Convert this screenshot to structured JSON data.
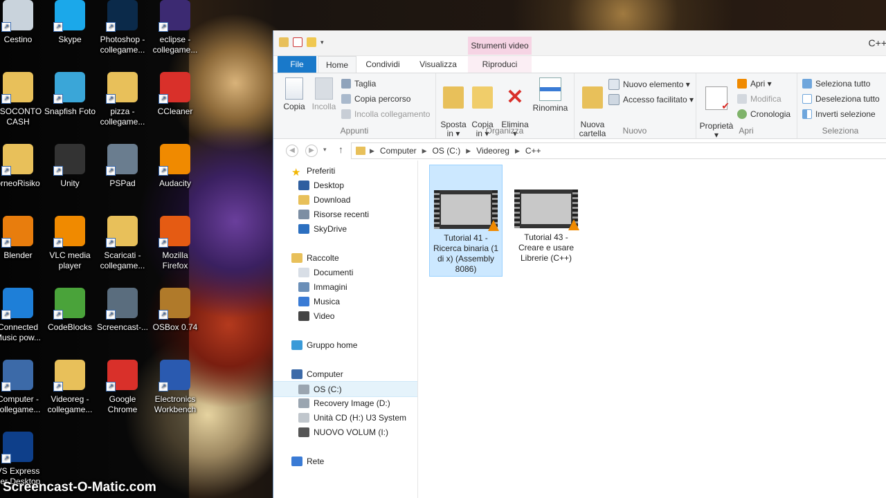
{
  "desktop": {
    "icons": [
      {
        "label": "Cestino",
        "icon": "recycle-bin-icon"
      },
      {
        "label": "Skype",
        "icon": "skype-icon"
      },
      {
        "label": "Photoshop -\ncollegame...",
        "icon": "photoshop-icon"
      },
      {
        "label": "eclipse -\ncollegame...",
        "icon": "eclipse-icon"
      },
      {
        "label": "ESOCONTO\nCASH",
        "icon": "folder-icon"
      },
      {
        "label": "Snapfish Foto",
        "icon": "snapfish-icon"
      },
      {
        "label": "pizza -\ncollegame...",
        "icon": "folder-icon"
      },
      {
        "label": "CCleaner",
        "icon": "ccleaner-icon"
      },
      {
        "label": "orneoRisiko",
        "icon": "folder-icon"
      },
      {
        "label": "Unity",
        "icon": "unity-icon"
      },
      {
        "label": "PSPad",
        "icon": "pspad-icon"
      },
      {
        "label": "Audacity",
        "icon": "audacity-icon"
      },
      {
        "label": "Blender",
        "icon": "blender-icon"
      },
      {
        "label": "VLC media\nplayer",
        "icon": "vlc-icon"
      },
      {
        "label": "Scaricati -\ncollegame...",
        "icon": "folder-icon"
      },
      {
        "label": "Mozilla\nFirefox",
        "icon": "firefox-icon"
      },
      {
        "label": "Connected\nMusic pow...",
        "icon": "music-icon"
      },
      {
        "label": "CodeBlocks",
        "icon": "codeblocks-icon"
      },
      {
        "label": "Screencast-...",
        "icon": "screencast-icon"
      },
      {
        "label": "OSBox 0.74",
        "icon": "dosbox-icon"
      },
      {
        "label": "Computer -\ncollegame...",
        "icon": "computer-icon"
      },
      {
        "label": "Videoreg -\ncollegame...",
        "icon": "folder-icon"
      },
      {
        "label": "Google\nChrome",
        "icon": "chrome-icon"
      },
      {
        "label": "Electronics\nWorkbench",
        "icon": "electronics-workbench-icon"
      },
      {
        "label": "VS Express\nper Desktop",
        "icon": "visual-studio-icon"
      }
    ]
  },
  "window": {
    "title": "C++",
    "contextual_tab": "Strumenti video",
    "tabs": [
      "File",
      "Home",
      "Condividi",
      "Visualizza",
      "Riproduci"
    ],
    "ribbon": {
      "appunti": {
        "label": "Appunti",
        "copia": "Copia",
        "incolla": "Incolla",
        "taglia": "Taglia",
        "copia_percorso": "Copia percorso",
        "incolla_collegamento": "Incolla collegamento"
      },
      "organizza": {
        "label": "Organizza",
        "sposta_in": "Sposta\nin ▾",
        "copia_in": "Copia\nin ▾",
        "elimina": "Elimina\n▾",
        "rinomina": "Rinomina"
      },
      "nuovo": {
        "label": "Nuovo",
        "nuova_cartella": "Nuova\ncartella",
        "nuovo_elemento": "Nuovo elemento ▾",
        "accesso_facilitato": "Accesso facilitato ▾"
      },
      "apri": {
        "label": "Apri",
        "proprieta": "Proprietà\n▾",
        "apri": "Apri ▾",
        "modifica": "Modifica",
        "cronologia": "Cronologia"
      },
      "seleziona": {
        "label": "Seleziona",
        "seleziona_tutto": "Seleziona tutto",
        "deseleziona_tutto": "Deseleziona tutto",
        "inverti_selezione": "Inverti selezione"
      }
    },
    "breadcrumb": [
      "Computer",
      "OS (C:)",
      "Videoreg",
      "C++"
    ],
    "nav": [
      {
        "label": "Preferiti",
        "icon": "star-icon",
        "indent": 0
      },
      {
        "label": "Desktop",
        "icon": "desktop-icon",
        "indent": 1
      },
      {
        "label": "Download",
        "icon": "download-folder-icon",
        "indent": 1
      },
      {
        "label": "Risorse recenti",
        "icon": "recent-places-icon",
        "indent": 1
      },
      {
        "label": "SkyDrive",
        "icon": "skydrive-icon",
        "indent": 1
      },
      {
        "label": "Raccolte",
        "icon": "libraries-icon",
        "indent": 0
      },
      {
        "label": "Documenti",
        "icon": "documents-icon",
        "indent": 1
      },
      {
        "label": "Immagini",
        "icon": "pictures-icon",
        "indent": 1
      },
      {
        "label": "Musica",
        "icon": "music-note-icon",
        "indent": 1
      },
      {
        "label": "Video",
        "icon": "video-icon",
        "indent": 1
      },
      {
        "label": "Gruppo home",
        "icon": "homegroup-icon",
        "indent": 0
      },
      {
        "label": "Computer",
        "icon": "computer-icon",
        "indent": 0
      },
      {
        "label": "OS (C:)",
        "icon": "drive-icon",
        "indent": 1,
        "selected": true
      },
      {
        "label": "Recovery Image (D:)",
        "icon": "drive-icon",
        "indent": 1
      },
      {
        "label": "Unità CD (H:) U3 System",
        "icon": "cd-drive-icon",
        "indent": 1
      },
      {
        "label": "NUOVO VOLUM (I:)",
        "icon": "usb-drive-icon",
        "indent": 1
      },
      {
        "label": "Rete",
        "icon": "network-icon",
        "indent": 0
      }
    ],
    "files": [
      {
        "name": "Tutorial 41 -\nRicerca binaria (1\ndi x) (Assembly\n8086)",
        "selected": true
      },
      {
        "name": "Tutorial 43 -\nCreare e usare\nLibrerie (C++)",
        "selected": false
      }
    ]
  },
  "watermark": "Screencast-O-Matic.com",
  "colors": {
    "file_tab": "#1979ca",
    "contextual_tab": "#f6d4e4",
    "selection": "#cce8ff",
    "folder": "#e8c05a"
  }
}
